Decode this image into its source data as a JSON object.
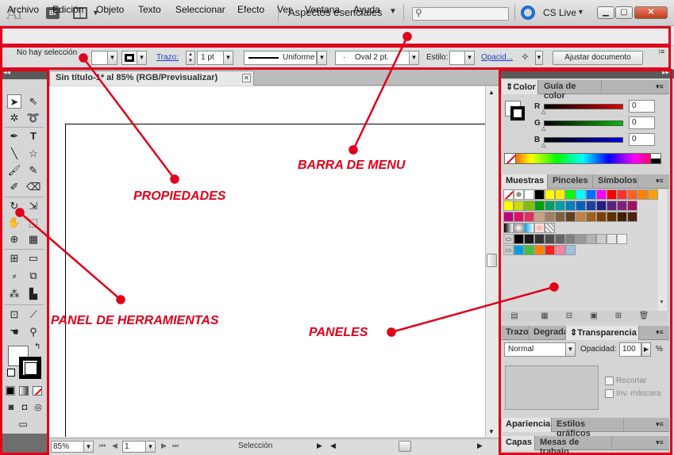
{
  "app": {
    "logo_text": "Ai",
    "bridge_label": "Br",
    "workspace": "Aspectos esenciales",
    "search_placeholder": "",
    "cslive_label": "CS Live"
  },
  "menu": [
    "Archivo",
    "Edición",
    "Objeto",
    "Texto",
    "Seleccionar",
    "Efecto",
    "Ver",
    "Ventana",
    "Ayuda"
  ],
  "control_bar": {
    "selection_status": "No hay selección",
    "stroke_label": "Trazo:",
    "stroke_weight": "1 pt",
    "stroke_profile": "Uniforme",
    "brush": "Oval 2 pt.",
    "style_label": "Estilo:",
    "opacity_label": "Opacid...",
    "adjust_button": "Ajustar documento"
  },
  "document": {
    "tab_title": "Sin título-1* al 85% (RGB/Previsualizar)",
    "zoom": "85%",
    "page": "1",
    "status": "Selección"
  },
  "color_panel": {
    "tabs": [
      "Color",
      "Guía de color"
    ],
    "channels": [
      {
        "label": "R",
        "value": "0",
        "color": "#e00000"
      },
      {
        "label": "G",
        "value": "0",
        "color": "#00c000"
      },
      {
        "label": "B",
        "value": "0",
        "color": "#0000e0"
      }
    ]
  },
  "swatches_panel": {
    "tabs": [
      "Muestras",
      "Pinceles",
      "Símbolos"
    ],
    "row1": [
      "#ffffff",
      "#000000",
      "#ffff00",
      "#ffee00",
      "#00ff00",
      "#00ffff",
      "#0070ff",
      "#ff00ff",
      "#ff0000",
      "#ff3030",
      "#ff6020",
      "#ff8000",
      "#ffa000"
    ],
    "row2": [
      "#ffff00",
      "#c8e000",
      "#80c000",
      "#00a000",
      "#00a060",
      "#00a0a0",
      "#0080c0",
      "#0060c0",
      "#2040a0",
      "#202080",
      "#602080",
      "#802080",
      "#a01060"
    ],
    "row3": [
      "#c00080",
      "#e01060",
      "#e03060",
      "#d0a080",
      "#a08060",
      "#806040",
      "#604020",
      "#c08040",
      "#a06020",
      "#804000",
      "#603000",
      "#402000",
      "#502010"
    ],
    "gray_row": [
      "#000000",
      "#1a1a1a",
      "#333333",
      "#4d4d4d",
      "#666666",
      "#808080",
      "#999999",
      "#b3b3b3",
      "#cccccc",
      "#e6e6e6",
      "#f2f2f2"
    ],
    "last_row": [
      "#00a0e0",
      "#40c040",
      "#ff8000",
      "#ff2020",
      "#ff80a0",
      "#a0c0e0"
    ]
  },
  "transparency_panel": {
    "tabs": [
      "Trazo",
      "Degrada",
      "Transparencia"
    ],
    "blend_mode": "Normal",
    "opacity_label": "Opacidad:",
    "opacity_value": "100",
    "opacity_unit": "%",
    "clip_label": "Recortar",
    "invert_label": "Inv. máscara"
  },
  "appearance_panel": {
    "tabs": [
      "Apariencia",
      "Estilos gráficos"
    ]
  },
  "layers_panel": {
    "tabs": [
      "Capas",
      "Mesas de trabajo"
    ]
  },
  "annotations": {
    "menu_bar": "BARRA DE MENU",
    "properties": "PROPIEDADES",
    "tools_panel": "PANEL DE HERRAMIENTAS",
    "panels": "PANELES"
  },
  "colors": {
    "annotation_red": "#e0001a"
  }
}
